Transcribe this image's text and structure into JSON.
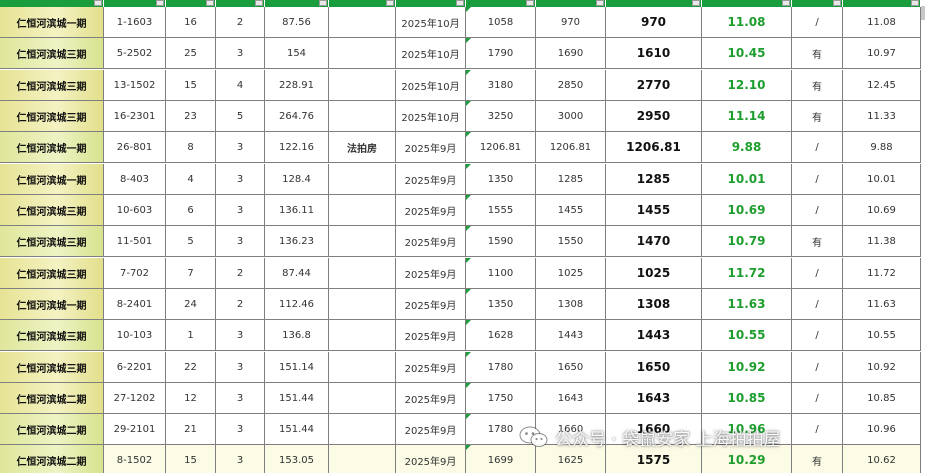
{
  "sheet": {
    "columns": [
      "name",
      "unit",
      "floor",
      "rooms",
      "area",
      "note",
      "date",
      "price1",
      "price2",
      "final",
      "unit_price",
      "flag",
      "last"
    ],
    "rows": [
      {
        "name": "仁恒河滨城一期",
        "unit": "1-1603",
        "floor": "16",
        "rooms": "2",
        "area": "87.56",
        "note": "",
        "date": "2025年10月",
        "price1": "1058",
        "price2": "970",
        "final": "970",
        "unit_price": "11.08",
        "flag": "/",
        "last": "11.08"
      },
      {
        "name": "仁恒河滨城三期",
        "unit": "5-2502",
        "floor": "25",
        "rooms": "3",
        "area": "154",
        "note": "",
        "date": "2025年10月",
        "price1": "1790",
        "price2": "1690",
        "final": "1610",
        "unit_price": "10.45",
        "flag": "有",
        "last": "10.97"
      },
      {
        "name": "仁恒河滨城三期",
        "unit": "13-1502",
        "floor": "15",
        "rooms": "4",
        "area": "228.91",
        "note": "",
        "date": "2025年10月",
        "price1": "3180",
        "price2": "2850",
        "final": "2770",
        "unit_price": "12.10",
        "flag": "有",
        "last": "12.45"
      },
      {
        "name": "仁恒河滨城三期",
        "unit": "16-2301",
        "floor": "23",
        "rooms": "5",
        "area": "264.76",
        "note": "",
        "date": "2025年10月",
        "price1": "3250",
        "price2": "3000",
        "final": "2950",
        "unit_price": "11.14",
        "flag": "有",
        "last": "11.33"
      },
      {
        "name": "仁恒河滨城一期",
        "unit": "26-801",
        "floor": "8",
        "rooms": "3",
        "area": "122.16",
        "note": "法拍房",
        "date": "2025年9月",
        "price1": "1206.81",
        "price2": "1206.81",
        "final": "1206.81",
        "unit_price": "9.88",
        "flag": "/",
        "last": "9.88"
      },
      {
        "name": "仁恒河滨城一期",
        "unit": "8-403",
        "floor": "4",
        "rooms": "3",
        "area": "128.4",
        "note": "",
        "date": "2025年9月",
        "price1": "1350",
        "price2": "1285",
        "final": "1285",
        "unit_price": "10.01",
        "flag": "/",
        "last": "10.01"
      },
      {
        "name": "仁恒河滨城三期",
        "unit": "10-603",
        "floor": "6",
        "rooms": "3",
        "area": "136.11",
        "note": "",
        "date": "2025年9月",
        "price1": "1555",
        "price2": "1455",
        "final": "1455",
        "unit_price": "10.69",
        "flag": "/",
        "last": "10.69"
      },
      {
        "name": "仁恒河滨城三期",
        "unit": "11-501",
        "floor": "5",
        "rooms": "3",
        "area": "136.23",
        "note": "",
        "date": "2025年9月",
        "price1": "1590",
        "price2": "1550",
        "final": "1470",
        "unit_price": "10.79",
        "flag": "有",
        "last": "11.38"
      },
      {
        "name": "仁恒河滨城三期",
        "unit": "7-702",
        "floor": "7",
        "rooms": "2",
        "area": "87.44",
        "note": "",
        "date": "2025年9月",
        "price1": "1100",
        "price2": "1025",
        "final": "1025",
        "unit_price": "11.72",
        "flag": "/",
        "last": "11.72"
      },
      {
        "name": "仁恒河滨城一期",
        "unit": "8-2401",
        "floor": "24",
        "rooms": "2",
        "area": "112.46",
        "note": "",
        "date": "2025年9月",
        "price1": "1350",
        "price2": "1308",
        "final": "1308",
        "unit_price": "11.63",
        "flag": "/",
        "last": "11.63"
      },
      {
        "name": "仁恒河滨城三期",
        "unit": "10-103",
        "floor": "1",
        "rooms": "3",
        "area": "136.8",
        "note": "",
        "date": "2025年9月",
        "price1": "1628",
        "price2": "1443",
        "final": "1443",
        "unit_price": "10.55",
        "flag": "/",
        "last": "10.55"
      },
      {
        "name": "仁恒河滨城三期",
        "unit": "6-2201",
        "floor": "22",
        "rooms": "3",
        "area": "151.14",
        "note": "",
        "date": "2025年9月",
        "price1": "1780",
        "price2": "1650",
        "final": "1650",
        "unit_price": "10.92",
        "flag": "/",
        "last": "10.92"
      },
      {
        "name": "仁恒河滨城二期",
        "unit": "27-1202",
        "floor": "12",
        "rooms": "3",
        "area": "151.44",
        "note": "",
        "date": "2025年9月",
        "price1": "1750",
        "price2": "1643",
        "final": "1643",
        "unit_price": "10.85",
        "flag": "/",
        "last": "10.85"
      },
      {
        "name": "仁恒河滨城二期",
        "unit": "29-2101",
        "floor": "21",
        "rooms": "3",
        "area": "151.44",
        "note": "",
        "date": "2025年9月",
        "price1": "1780",
        "price2": "1660",
        "final": "1660",
        "unit_price": "10.96",
        "flag": "/",
        "last": "10.96"
      },
      {
        "name": "仁恒河滨城二期",
        "unit": "8-1502",
        "floor": "15",
        "rooms": "3",
        "area": "153.05",
        "note": "",
        "date": "2025年9月",
        "price1": "1699",
        "price2": "1625",
        "final": "1575",
        "unit_price": "10.29",
        "flag": "有",
        "last": "10.62"
      }
    ]
  },
  "watermark": {
    "text": "公众号 · 袋鼠安家 上海拍拍屋",
    "icon": "wechat-icon"
  },
  "colors": {
    "header_green": "#1a9e3d",
    "unit_price_green": "#1e9e2e",
    "name_cell_yellow": "#f4f2c2",
    "grid_line": "#7f7f7f"
  }
}
